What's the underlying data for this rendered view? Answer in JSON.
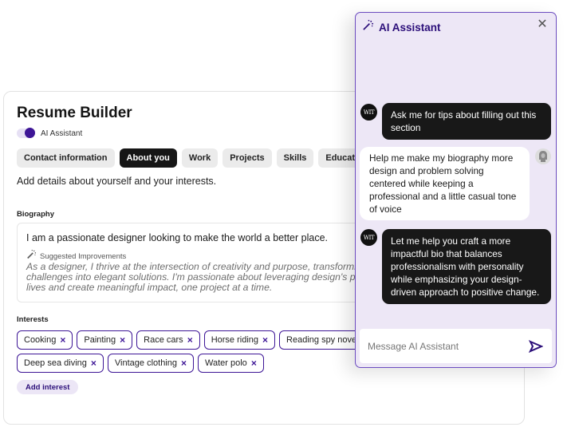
{
  "colors": {
    "accent": "#3d1596",
    "accent_dark": "#2c0f7a",
    "panel_bg": "#ede7f6",
    "dark_bubble": "#181818",
    "tab_bg": "#ebebeb"
  },
  "resume_builder": {
    "title": "Resume Builder",
    "ai_toggle": {
      "label": "AI Assistant",
      "on": true
    },
    "tabs": [
      {
        "label": "Contact information",
        "active": false
      },
      {
        "label": "About you",
        "active": true
      },
      {
        "label": "Work",
        "active": false
      },
      {
        "label": "Projects",
        "active": false
      },
      {
        "label": "Skills",
        "active": false
      },
      {
        "label": "Education",
        "active": false
      }
    ],
    "section_description": "Add details about yourself and your interests.",
    "biography": {
      "label": "Biography",
      "value": "I am a passionate designer looking to make the world a better place.",
      "suggestion_icon": "magic-wand-icon",
      "suggestion_label": "Suggested Improvements",
      "suggestion_text": "As a designer, I thrive at the intersection of creativity and purpose, transforming complex challenges into elegant solutions. I'm passionate about leveraging design's potential to enhance lives and create meaningful impact, one project at a time."
    },
    "interests": {
      "label": "Interests",
      "items": [
        "Cooking",
        "Painting",
        "Race cars",
        "Horse riding",
        "Reading spy novels",
        "Deep sea diving",
        "Vintage clothing",
        "Water polo"
      ],
      "remove_glyph": "×",
      "add_label": "Add interest"
    }
  },
  "ai_assistant": {
    "title": "AI Assistant",
    "title_icon": "magic-wand-icon",
    "close_glyph": "✕",
    "bot_avatar_text": "WIT",
    "messages": [
      {
        "role": "assistant",
        "text": "Ask me for tips about filling out this section"
      },
      {
        "role": "user",
        "text": "Help me make my biography more design and problem solving centered while keeping a professional and a little casual tone of voice"
      },
      {
        "role": "assistant",
        "text": "Let me help you craft a more impactful bio that balances professionalism with personality while emphasizing your design-driven approach to positive change."
      }
    ],
    "input_placeholder": "Message AI Assistant",
    "send_icon": "send-icon"
  }
}
